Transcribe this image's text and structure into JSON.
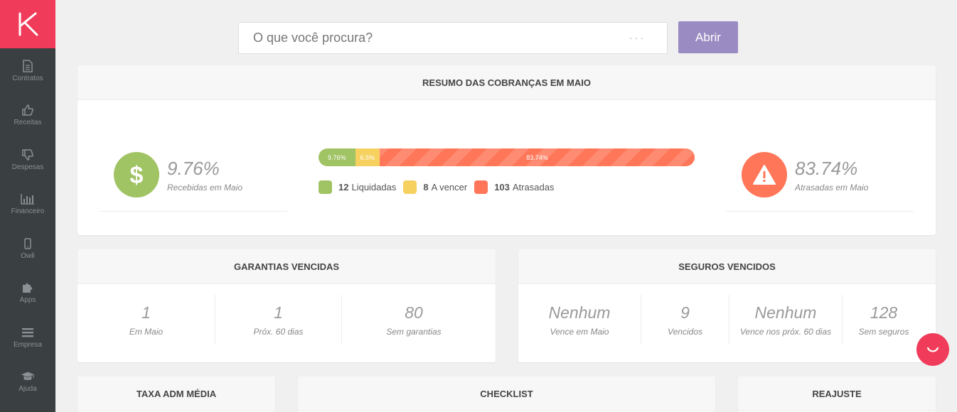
{
  "sidebar": {
    "items": [
      {
        "label": "Contratos",
        "icon": "document-icon"
      },
      {
        "label": "Receitas",
        "icon": "thumbs-up-icon"
      },
      {
        "label": "Despesas",
        "icon": "thumbs-down-icon"
      },
      {
        "label": "Financeiro",
        "icon": "bar-chart-icon"
      },
      {
        "label": "Owli",
        "icon": "mobile-icon"
      },
      {
        "label": "Apps",
        "icon": "puzzle-icon"
      },
      {
        "label": "Empresa",
        "icon": "menu-lines-icon"
      },
      {
        "label": "Ajuda",
        "icon": "graduation-cap-icon"
      }
    ]
  },
  "search": {
    "placeholder": "O que você procura?",
    "dots": "···",
    "button_label": "Abrir"
  },
  "summary": {
    "title": "RESUMO DAS COBRANÇAS EM MAIO",
    "received": {
      "pct": "9.76%",
      "label": "Recebidas em Maio"
    },
    "overdue": {
      "pct": "83.74%",
      "label": "Atrasadas em Maio"
    },
    "progress": [
      {
        "label": "9.76%",
        "value": 9.76,
        "class": "seg-green"
      },
      {
        "label": "6.5%",
        "value": 6.5,
        "class": "seg-yellow"
      },
      {
        "label": "83.74%",
        "value": 83.74,
        "class": "seg-red"
      }
    ],
    "legend": [
      {
        "count": "12",
        "label": "Liquidadas",
        "color": "#a0c364"
      },
      {
        "count": "8",
        "label": "A vencer",
        "color": "#f6d160"
      },
      {
        "count": "103",
        "label": "Atrasadas",
        "color": "#ff7658"
      }
    ]
  },
  "guarantees": {
    "title": "GARANTIAS VENCIDAS",
    "cells": [
      {
        "value": "1",
        "label": "Em Maio"
      },
      {
        "value": "1",
        "label": "Próx. 60 dias"
      },
      {
        "value": "80",
        "label": "Sem garantias"
      }
    ]
  },
  "insurance": {
    "title": "SEGUROS VENCIDOS",
    "cells": [
      {
        "value": "Nenhum",
        "label": "Vence em Maio"
      },
      {
        "value": "9",
        "label": "Vencidos"
      },
      {
        "value": "Nenhum",
        "label": "Vence nos próx. 60 dias"
      },
      {
        "value": "128",
        "label": "Sem seguros"
      }
    ]
  },
  "bottom_cards": {
    "fee": "TAXA ADM MÉDIA",
    "checklist": "CHECKLIST",
    "adjust": "REAJUSTE"
  },
  "colors": {
    "brand": "#f03c5a",
    "sidebar": "#3a3f41",
    "button": "#9a8bc2",
    "green": "#a0c364",
    "yellow": "#f6d160",
    "red": "#ff7658"
  }
}
